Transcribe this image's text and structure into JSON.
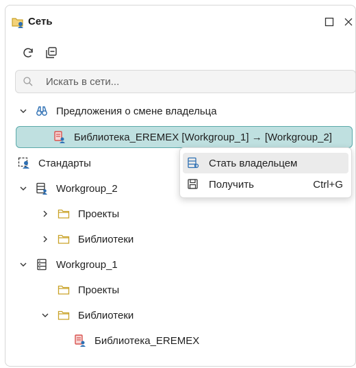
{
  "window": {
    "title": "Сеть"
  },
  "search": {
    "placeholder": "Искать в сети..."
  },
  "tree": {
    "proposals": "Предложения о смене владельца",
    "library_proposal": "Библиотека_EREMEX [Workgroup_1] → [Workgroup_2]",
    "standards": "Стандарты",
    "wg2": "Workgroup_2",
    "wg2_projects": "Проекты",
    "wg2_libraries": "Библиотеки",
    "wg1": "Workgroup_1",
    "wg1_projects": "Проекты",
    "wg1_libraries": "Библиотеки",
    "wg1_library_item": "Библиотека_EREMEX"
  },
  "context_menu": {
    "items": [
      {
        "label": "Стать владельцем",
        "shortcut": ""
      },
      {
        "label": "Получить",
        "shortcut": "Ctrl+G"
      }
    ]
  },
  "colors": {
    "selection_bg": "#bfe0e0",
    "selection_border": "#5aa9a9",
    "folder": "#c9a227",
    "library_red": "#d9534f",
    "user_blue": "#2d6fb3"
  }
}
